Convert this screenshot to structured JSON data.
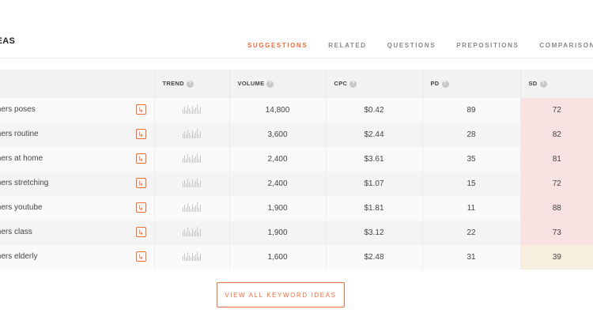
{
  "section": {
    "title": "IDEAS"
  },
  "tabs": [
    {
      "label": "SUGGESTIONS",
      "active": true
    },
    {
      "label": "RELATED",
      "active": false
    },
    {
      "label": "QUESTIONS",
      "active": false
    },
    {
      "label": "PREPOSITIONS",
      "active": false
    },
    {
      "label": "COMPARISONS",
      "active": false
    }
  ],
  "table": {
    "headers": {
      "keyword": "",
      "trend": "TREND",
      "volume": "VOLUME",
      "cpc": "CPC",
      "pd": "PD",
      "sd": "SD"
    },
    "rows": [
      {
        "keyword": "inners poses",
        "volume": "14,800",
        "cpc": "$0.42",
        "pd": "89",
        "sd": "72",
        "sd_level": "hard"
      },
      {
        "keyword": "inners routine",
        "volume": "3,600",
        "cpc": "$2.44",
        "pd": "28",
        "sd": "82",
        "sd_level": "hard"
      },
      {
        "keyword": "inners at home",
        "volume": "2,400",
        "cpc": "$3.61",
        "pd": "35",
        "sd": "81",
        "sd_level": "hard"
      },
      {
        "keyword": "inners stretching",
        "volume": "2,400",
        "cpc": "$1.07",
        "pd": "15",
        "sd": "72",
        "sd_level": "hard"
      },
      {
        "keyword": "inners youtube",
        "volume": "1,900",
        "cpc": "$1.81",
        "pd": "11",
        "sd": "88",
        "sd_level": "hard"
      },
      {
        "keyword": "inners class",
        "volume": "1,900",
        "cpc": "$3.12",
        "pd": "22",
        "sd": "73",
        "sd_level": "hard"
      },
      {
        "keyword": "inners elderly",
        "volume": "1,600",
        "cpc": "$2.48",
        "pd": "31",
        "sd": "39",
        "sd_level": "medium"
      }
    ]
  },
  "icons": {
    "help": "question-circle-icon",
    "serp": "arrow-return-icon",
    "trend": "sparkline-icon",
    "help_glyph": "?",
    "serp_glyph": "↳"
  },
  "colors": {
    "accent": "#f26b3a",
    "sd_hard": "#f9e2e2",
    "sd_medium": "#f8eedd"
  },
  "button": {
    "view_all": "VIEW ALL KEYWORD IDEAS"
  }
}
